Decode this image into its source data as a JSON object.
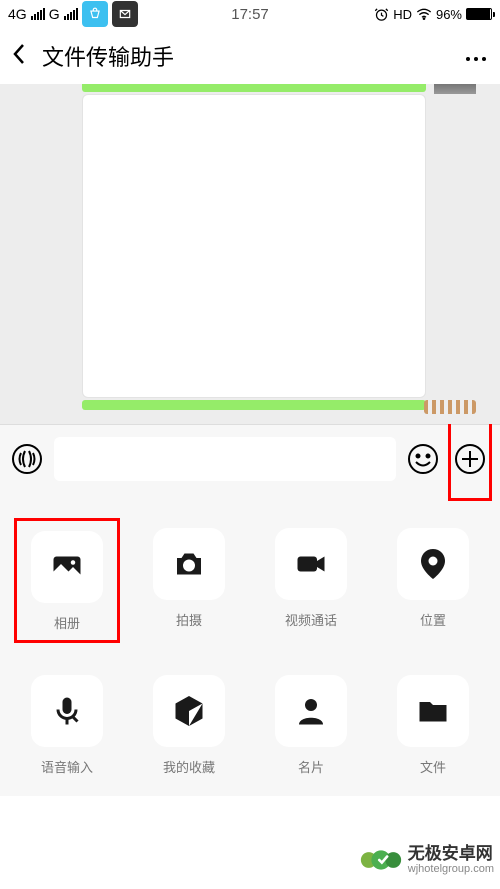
{
  "status": {
    "net1": "4G",
    "net2": "G",
    "time": "17:57",
    "hd": "HD",
    "battery_pct": "96%"
  },
  "nav": {
    "title": "文件传输助手"
  },
  "input": {
    "value": ""
  },
  "attachments": [
    {
      "id": "album",
      "label": "相册"
    },
    {
      "id": "camera",
      "label": "拍摄"
    },
    {
      "id": "video-call",
      "label": "视频通话"
    },
    {
      "id": "location",
      "label": "位置"
    },
    {
      "id": "voice-input",
      "label": "语音输入"
    },
    {
      "id": "favorites",
      "label": "我的收藏"
    },
    {
      "id": "contact-card",
      "label": "名片"
    },
    {
      "id": "file",
      "label": "文件"
    }
  ],
  "watermark": {
    "title": "无极安卓网",
    "url": "wjhotelgroup.com"
  }
}
